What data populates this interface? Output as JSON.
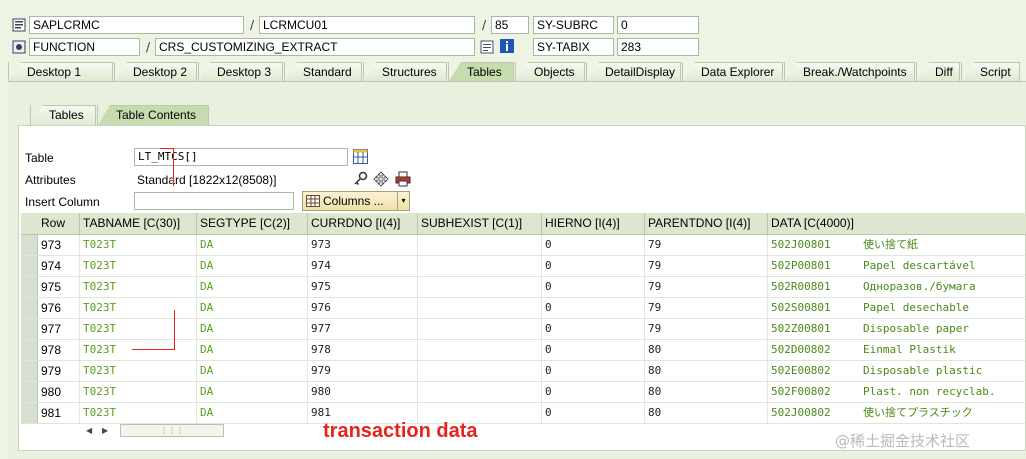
{
  "header": {
    "program": "SAPLCRMC",
    "include": "LCRMCU01",
    "line": "85",
    "event_type": "FUNCTION",
    "event_name": "CRS_CUSTOMIZING_EXTRACT",
    "sysvars": [
      {
        "name": "SY-SUBRC",
        "value": "0"
      },
      {
        "name": "SY-TABIX",
        "value": "283"
      }
    ]
  },
  "tabs": [
    "Desktop 1",
    "Desktop 2",
    "Desktop 3",
    "Standard",
    "Structures",
    "Tables",
    "Objects",
    "DetailDisplay",
    "Data Explorer",
    "Break./Watchpoints",
    "Diff",
    "Script"
  ],
  "active_tab": "Tables",
  "subtabs": [
    "Tables",
    "Table Contents"
  ],
  "active_subtab": "Table Contents",
  "form": {
    "table_label": "Table",
    "table_value": "LT_MTCS[]",
    "attributes_label": "Attributes",
    "attributes_value": "Standard [1822x12(8508)]",
    "insert_column_label": "Insert Column",
    "insert_column_value": "",
    "columns_button": "Columns ..."
  },
  "grid": {
    "columns": [
      "Row",
      "TABNAME [C(30)]",
      "SEGTYPE [C(2)]",
      "CURRDNO [I(4)]",
      "SUBHEXIST [C(1)]",
      "HIERNO [I(4)]",
      "PARENTDNO [I(4)]",
      "DATA [C(4000)]"
    ],
    "rows": [
      {
        "row": "973",
        "tabname": "T023T",
        "segtype": "DA",
        "currdno": "973",
        "subhexist": "",
        "hierno": "0",
        "parentdno": "79",
        "data_key": "502J00801",
        "data_text": "使い捨て紙"
      },
      {
        "row": "974",
        "tabname": "T023T",
        "segtype": "DA",
        "currdno": "974",
        "subhexist": "",
        "hierno": "0",
        "parentdno": "79",
        "data_key": "502P00801",
        "data_text": "Papel descartável"
      },
      {
        "row": "975",
        "tabname": "T023T",
        "segtype": "DA",
        "currdno": "975",
        "subhexist": "",
        "hierno": "0",
        "parentdno": "79",
        "data_key": "502R00801",
        "data_text": "Одноразов./бумага"
      },
      {
        "row": "976",
        "tabname": "T023T",
        "segtype": "DA",
        "currdno": "976",
        "subhexist": "",
        "hierno": "0",
        "parentdno": "79",
        "data_key": "502S00801",
        "data_text": "Papel desechable"
      },
      {
        "row": "977",
        "tabname": "T023T",
        "segtype": "DA",
        "currdno": "977",
        "subhexist": "",
        "hierno": "0",
        "parentdno": "79",
        "data_key": "502Z00801",
        "data_text": "Disposable paper"
      },
      {
        "row": "978",
        "tabname": "T023T",
        "segtype": "DA",
        "currdno": "978",
        "subhexist": "",
        "hierno": "0",
        "parentdno": "80",
        "data_key": "502D00802",
        "data_text": "Einmal Plastik"
      },
      {
        "row": "979",
        "tabname": "T023T",
        "segtype": "DA",
        "currdno": "979",
        "subhexist": "",
        "hierno": "0",
        "parentdno": "80",
        "data_key": "502E00802",
        "data_text": "Disposable plastic"
      },
      {
        "row": "980",
        "tabname": "T023T",
        "segtype": "DA",
        "currdno": "980",
        "subhexist": "",
        "hierno": "0",
        "parentdno": "80",
        "data_key": "502F00802",
        "data_text": "Plast. non recyclab."
      },
      {
        "row": "981",
        "tabname": "T023T",
        "segtype": "DA",
        "currdno": "981",
        "subhexist": "",
        "hierno": "0",
        "parentdno": "80",
        "data_key": "502J00802",
        "data_text": "使い捨てプラスチック"
      }
    ]
  },
  "annotation": "transaction data",
  "watermark": "@稀土掘金技术社区",
  "colors": {
    "annotation": "#e8231b",
    "data_green": "#5a9e1a",
    "active_tab": "#c7dcae"
  },
  "icons": [
    "program-icon",
    "function-icon",
    "source-icon",
    "info-icon",
    "table-picker-icon",
    "key-icon",
    "move-icon",
    "print-icon",
    "columns-icon"
  ]
}
